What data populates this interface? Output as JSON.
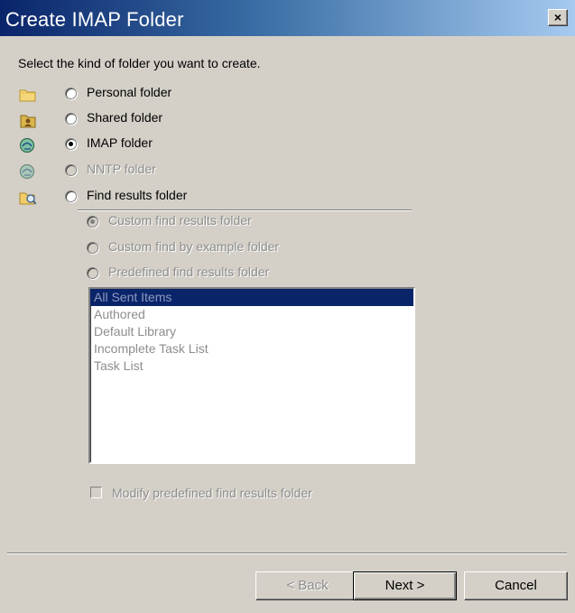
{
  "window": {
    "title": "Create IMAP Folder",
    "close_label": "×"
  },
  "prompt": "Select the kind of folder you want to create.",
  "folder_types": [
    {
      "label": "Personal folder",
      "icon": "folder-icon",
      "checked": false,
      "disabled": false
    },
    {
      "label": "Shared folder",
      "icon": "shared-folder-icon",
      "checked": false,
      "disabled": false
    },
    {
      "label": "IMAP folder",
      "icon": "imap-folder-icon",
      "checked": true,
      "disabled": false
    },
    {
      "label": "NNTP folder",
      "icon": "nntp-folder-icon",
      "checked": false,
      "disabled": true
    },
    {
      "label": "Find results folder",
      "icon": "find-results-folder-icon",
      "checked": false,
      "disabled": false
    }
  ],
  "find_options": [
    {
      "label": "Custom find results folder",
      "checked": true
    },
    {
      "label": "Custom find by example folder",
      "checked": false
    },
    {
      "label": "Predefined find results folder",
      "checked": false
    }
  ],
  "predefined_list": {
    "items": [
      "All Sent Items",
      "Authored",
      "Default Library",
      "Incomplete Task List",
      "Task List"
    ],
    "selected_index": 0
  },
  "modify_checkbox": {
    "label": "Modify predefined find results folder",
    "checked": false
  },
  "buttons": {
    "back": "< Back",
    "next": "Next >",
    "cancel": "Cancel"
  }
}
